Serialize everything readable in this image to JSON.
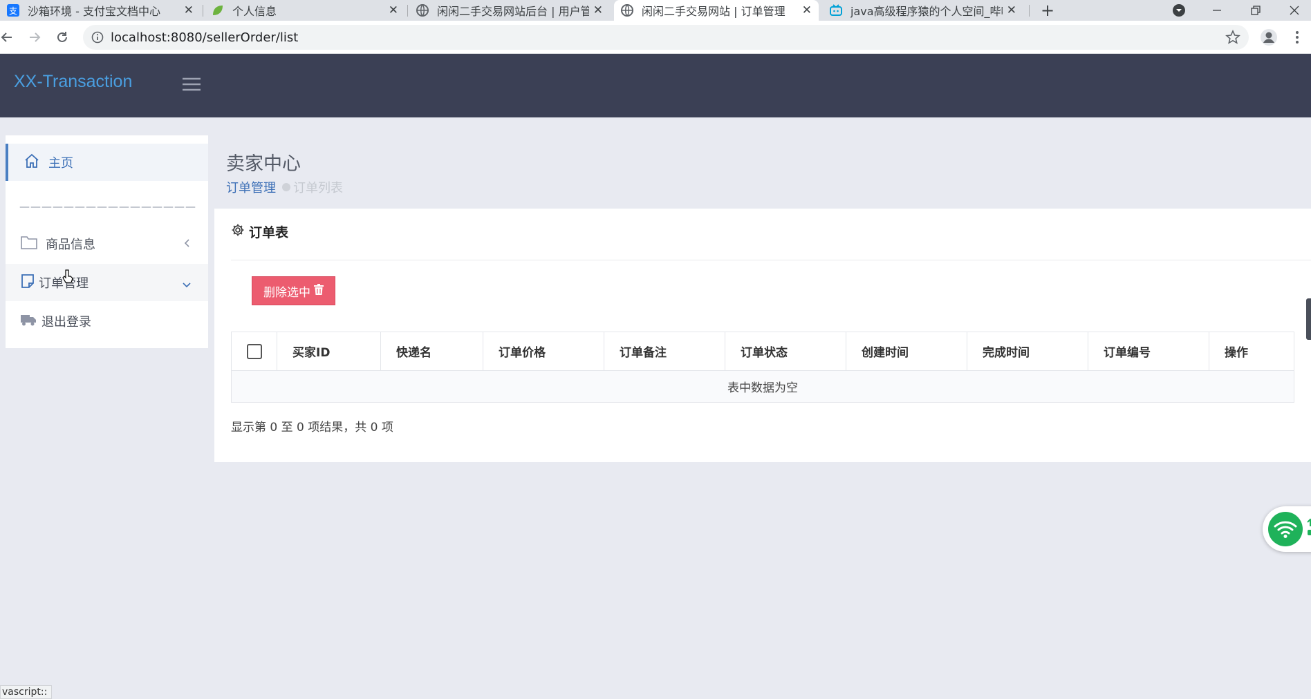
{
  "browser": {
    "tabs": [
      {
        "title": "沙箱环境 - 支付宝文档中心",
        "icon": "alipay-icon",
        "active": false
      },
      {
        "title": "个人信息",
        "icon": "leaf-icon",
        "active": false
      },
      {
        "title": "闲闲二手交易网站后台 | 用户管理",
        "icon": "globe-icon",
        "active": false
      },
      {
        "title": "闲闲二手交易网站 | 订单管理",
        "icon": "globe-icon",
        "active": true
      },
      {
        "title": "java高级程序猿的个人空间_哔哩哔哩",
        "icon": "bilibili-icon",
        "active": false
      }
    ],
    "url": "localhost:8080/sellerOrder/list",
    "status_text": "vascript::"
  },
  "app": {
    "brand": "XX-Transaction",
    "accent": "#4a9fe1",
    "header_bg": "#3b4055"
  },
  "sidebar": {
    "items": [
      {
        "label": "主页",
        "icon": "home-icon",
        "active": true
      },
      {
        "label": "商品信息",
        "icon": "folder-icon",
        "chevron": "chevron-left-icon"
      },
      {
        "label": "订单管理",
        "icon": "note-icon",
        "chevron": "chevron-down-icon"
      },
      {
        "label": "退出登录",
        "icon": "truck-icon"
      }
    ],
    "divider": "————————————————"
  },
  "main": {
    "title": "卖家中心",
    "breadcrumb": {
      "link": "订单管理",
      "current": "订单列表"
    },
    "panel_title": "订单表",
    "delete_button": "删除选中",
    "delete_color": "#ec5c6f",
    "table": {
      "columns": [
        "买家ID",
        "快递名",
        "订单价格",
        "订单备注",
        "订单状态",
        "创建时间",
        "完成时间",
        "订单编号",
        "操作"
      ],
      "empty_text": "表中数据为空"
    },
    "summary": "显示第 0 至 0 项结果，共 0 项"
  }
}
